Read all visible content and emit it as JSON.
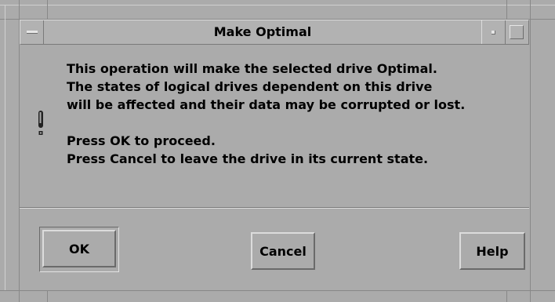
{
  "dialog": {
    "title": "Make Optimal",
    "icon": "warning-exclamation-icon",
    "message_lines": [
      "This operation will make the selected drive Optimal.",
      "The states of logical drives dependent on this drive",
      "will be affected and their data may be corrupted or lost."
    ],
    "instruction_lines": [
      "Press OK to proceed.",
      "Press Cancel to leave the drive in its current state."
    ]
  },
  "buttons": {
    "ok": "OK",
    "cancel": "Cancel",
    "help": "Help"
  },
  "window_controls": {
    "menu_icon": "window-menu-icon",
    "minimize_icon": "minimize-icon",
    "maximize_icon": "maximize-icon"
  }
}
